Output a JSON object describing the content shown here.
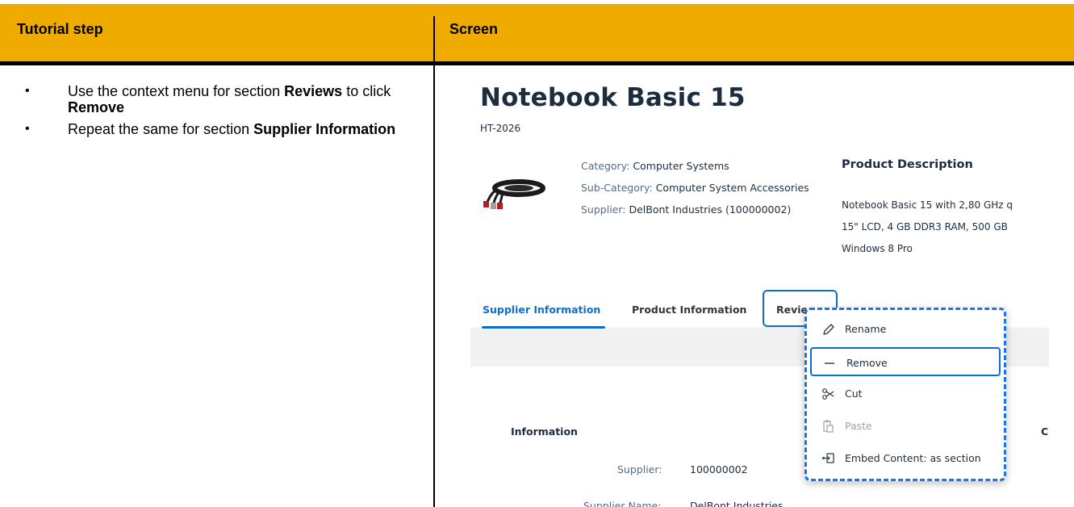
{
  "table": {
    "header_left": "Tutorial step",
    "header_right": "Screen"
  },
  "steps": [
    {
      "pre": "Use the context menu for section ",
      "b1": "Reviews",
      "mid": " to click ",
      "b2": "Remove"
    },
    {
      "pre": "Repeat the same for section ",
      "b1": "Supplier Information"
    }
  ],
  "product": {
    "title": "Notebook Basic 15",
    "id": "HT-2026",
    "category_label": "Category:",
    "category_value": "Computer Systems",
    "subcategory_label": "Sub-Category:",
    "subcategory_value": "Computer System Accessories",
    "supplier_label": "Supplier:",
    "supplier_value": "DelBont Industries (100000002)",
    "description_title": "Product Description",
    "description_lines": [
      "Notebook Basic 15 with 2,80 GHz q",
      "15\" LCD, 4 GB DDR3 RAM, 500 GB",
      "Windows 8 Pro"
    ]
  },
  "tabs": [
    {
      "label": "Supplier Information"
    },
    {
      "label": "Product Information"
    },
    {
      "label": "Revie"
    }
  ],
  "section": {
    "title": "Information",
    "right_char": "C",
    "supplier_label": "Supplier:",
    "supplier_value": "100000002",
    "supplier_name_label": "Supplier Name:",
    "supplier_name_value": "DelBont Industries"
  },
  "context_menu": {
    "items": [
      {
        "label": "Rename",
        "icon": "pencil-icon",
        "enabled": true
      },
      {
        "label": "Remove",
        "icon": "minus-icon",
        "enabled": true,
        "selected": true
      },
      {
        "label": "Cut",
        "icon": "scissors-icon",
        "enabled": true
      },
      {
        "label": "Paste",
        "icon": "paste-icon",
        "enabled": false
      },
      {
        "label": "Embed Content: as section",
        "icon": "embed-icon",
        "enabled": true
      }
    ]
  },
  "colors": {
    "header_bg": "#f0ab00",
    "accent": "#0a6ed1",
    "menu_border": "#1a73e8"
  }
}
